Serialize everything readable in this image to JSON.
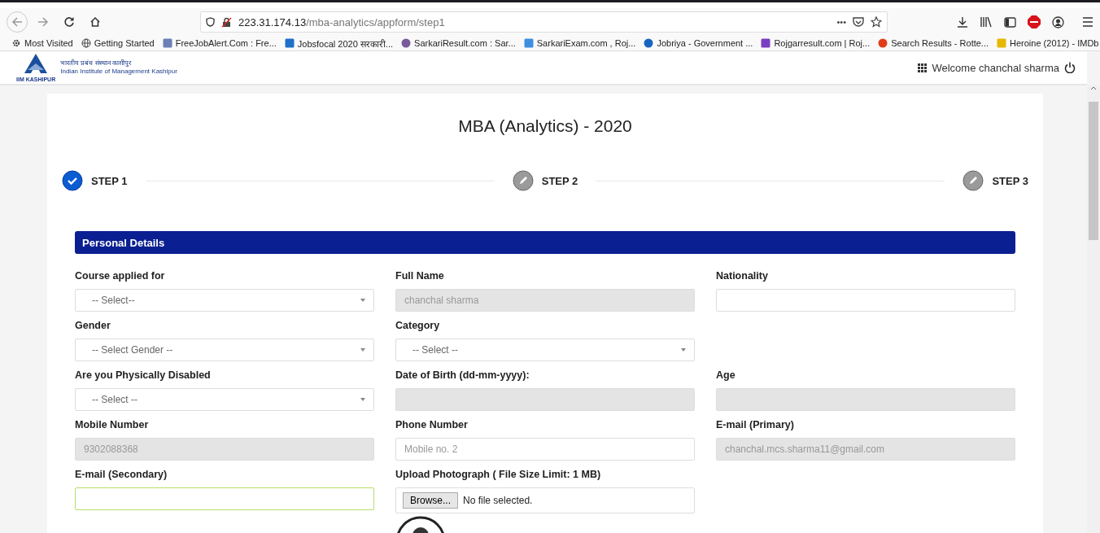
{
  "browser": {
    "url_host": "223.31.174.13",
    "url_path": "/mba-analytics/appform/step1",
    "more": "•••",
    "bookmarks": [
      {
        "label": "Most Visited",
        "kind": "gear"
      },
      {
        "label": "Getting Started",
        "kind": "globe"
      },
      {
        "label": "FreeJobAlert.Com : Fre...",
        "kind": "site",
        "color": "#6a7fb5"
      },
      {
        "label": "Jobsfocal 2020 सरकारी...",
        "kind": "site",
        "color": "#1e6fc9"
      },
      {
        "label": "SarkariResult.com : Sar...",
        "kind": "dot",
        "color": "#7a5a9a"
      },
      {
        "label": "SarkariExam.com , Roj...",
        "kind": "site",
        "color": "#3f8fe0"
      },
      {
        "label": "Jobriya - Government ...",
        "kind": "dot",
        "color": "#1565c0"
      },
      {
        "label": "Rojgarresult.com | Roj...",
        "kind": "site",
        "color": "#7a3fc0"
      },
      {
        "label": "Search Results - Rotte...",
        "kind": "dot",
        "color": "#e23b1a"
      },
      {
        "label": "Heroine (2012) - IMDb",
        "kind": "site",
        "color": "#e6b800"
      }
    ]
  },
  "header": {
    "logo_hindi": "भारतीय प्रबंध संस्थान काशीपुर",
    "logo_english": "Indian Institute of Management Kashipur",
    "logo_caption": "IIM KASHIPUR",
    "welcome": "Welcome chanchal sharma"
  },
  "page": {
    "title": "MBA (Analytics) - 2020",
    "steps": [
      {
        "label": "STEP 1",
        "completed": true
      },
      {
        "label": "STEP 2",
        "completed": false
      },
      {
        "label": "STEP 3",
        "completed": false
      }
    ],
    "section": "Personal Details",
    "rows": [
      [
        {
          "label": "Course applied for",
          "kind": "select",
          "placeholder": "-- Select--",
          "disabled": false,
          "focused": false
        },
        {
          "label": "Full Name",
          "kind": "text",
          "value": "chanchal sharma",
          "disabled": true,
          "focused": false
        },
        {
          "label": "Nationality",
          "kind": "text",
          "disabled": false,
          "focused": false
        }
      ],
      [
        {
          "label": "Gender",
          "kind": "select",
          "placeholder": "-- Select Gender --",
          "disabled": false,
          "focused": false
        },
        {
          "label": "Category",
          "kind": "select",
          "placeholder": "-- Select --",
          "disabled": false,
          "focused": false
        }
      ],
      [
        {
          "label": "Are you Physically Disabled",
          "kind": "select",
          "placeholder": "-- Select --",
          "disabled": false,
          "focused": false
        },
        {
          "label": "Date of Birth (dd-mm-yyyy):",
          "kind": "text",
          "disabled": true,
          "focused": false
        },
        {
          "label": "Age",
          "kind": "text",
          "disabled": true,
          "focused": false
        }
      ],
      [
        {
          "label": "Mobile Number",
          "kind": "text",
          "value": "9302088368",
          "disabled": true,
          "focused": false
        },
        {
          "label": "Phone Number",
          "kind": "text",
          "placeholder": "Mobile no. 2",
          "disabled": false,
          "focused": false
        },
        {
          "label": "E-mail (Primary)",
          "kind": "text",
          "value": "chanchal.mcs.sharma11@gmail.com",
          "disabled": true,
          "focused": false
        }
      ],
      [
        {
          "label": "E-mail (Secondary)",
          "kind": "text",
          "disabled": false,
          "focused": true
        },
        {
          "label": "Upload Photograph ( File Size Limit: 1 MB)",
          "kind": "file",
          "button": "Browse...",
          "status": "No file selected.",
          "disabled": false,
          "focused": false
        }
      ]
    ]
  }
}
